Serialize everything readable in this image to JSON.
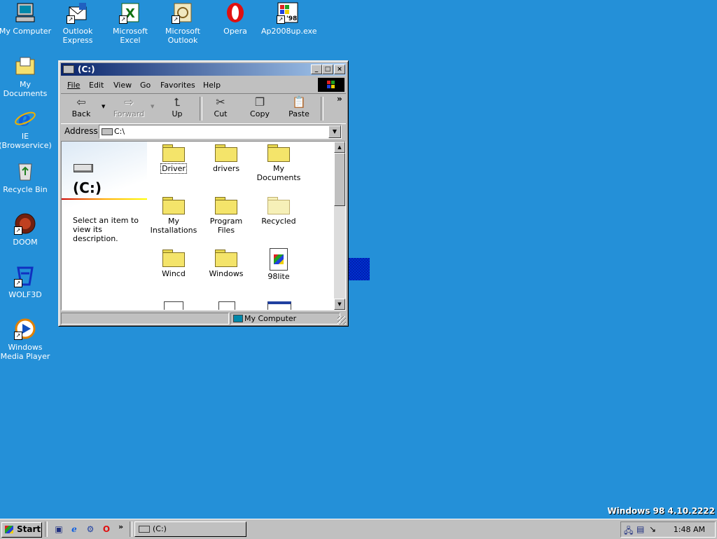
{
  "desktop": {
    "icons": [
      {
        "label": "My Computer",
        "icon": "computer-icon"
      },
      {
        "label": "Outlook Express",
        "icon": "outlook-express-icon"
      },
      {
        "label": "Microsoft Excel",
        "icon": "excel-icon"
      },
      {
        "label": "Microsoft Outlook",
        "icon": "outlook-icon"
      },
      {
        "label": "Opera",
        "icon": "opera-icon"
      },
      {
        "label": "Ap2008up.exe",
        "icon": "windows98-setup-icon"
      },
      {
        "label": "My Documents",
        "icon": "folder-documents-icon"
      },
      {
        "label": "IE (Browservice)",
        "icon": "ie-icon"
      },
      {
        "label": "Recycle Bin",
        "icon": "recycle-bin-icon"
      },
      {
        "label": "DOOM",
        "icon": "doom-icon"
      },
      {
        "label": "WOLF3D",
        "icon": "wolf3d-icon"
      },
      {
        "label": "Windows Media Player",
        "icon": "media-player-icon"
      }
    ],
    "version_text": "Windows 98 4.10.2222"
  },
  "window": {
    "title": "(C:)",
    "menu": [
      "File",
      "Edit",
      "View",
      "Go",
      "Favorites",
      "Help"
    ],
    "toolbar": {
      "back": "Back",
      "forward": "Forward",
      "up": "Up",
      "cut": "Cut",
      "copy": "Copy",
      "paste": "Paste",
      "more": "»"
    },
    "address": {
      "label": "Address",
      "value": "C:\\"
    },
    "left_pane": {
      "drive_title": "(C:)",
      "description": "Select an item to view its description."
    },
    "files": [
      {
        "name": "Driver",
        "type": "folder"
      },
      {
        "name": "drivers",
        "type": "folder"
      },
      {
        "name": "My Documents",
        "type": "folder"
      },
      {
        "name": "My Installations",
        "type": "folder"
      },
      {
        "name": "Program Files",
        "type": "folder"
      },
      {
        "name": "Recycled",
        "type": "folder-hidden"
      },
      {
        "name": "Wincd",
        "type": "folder"
      },
      {
        "name": "Windows",
        "type": "folder"
      },
      {
        "name": "98lite",
        "type": "setup-file"
      }
    ],
    "status": {
      "location": "My Computer"
    }
  },
  "taskbar": {
    "start_label": "Start",
    "quicklaunch": [
      "show-desktop-icon",
      "ie-icon",
      "channels-icon",
      "opera-icon"
    ],
    "more": "»",
    "task_button": "(C:)",
    "clock": "1:48 AM"
  }
}
